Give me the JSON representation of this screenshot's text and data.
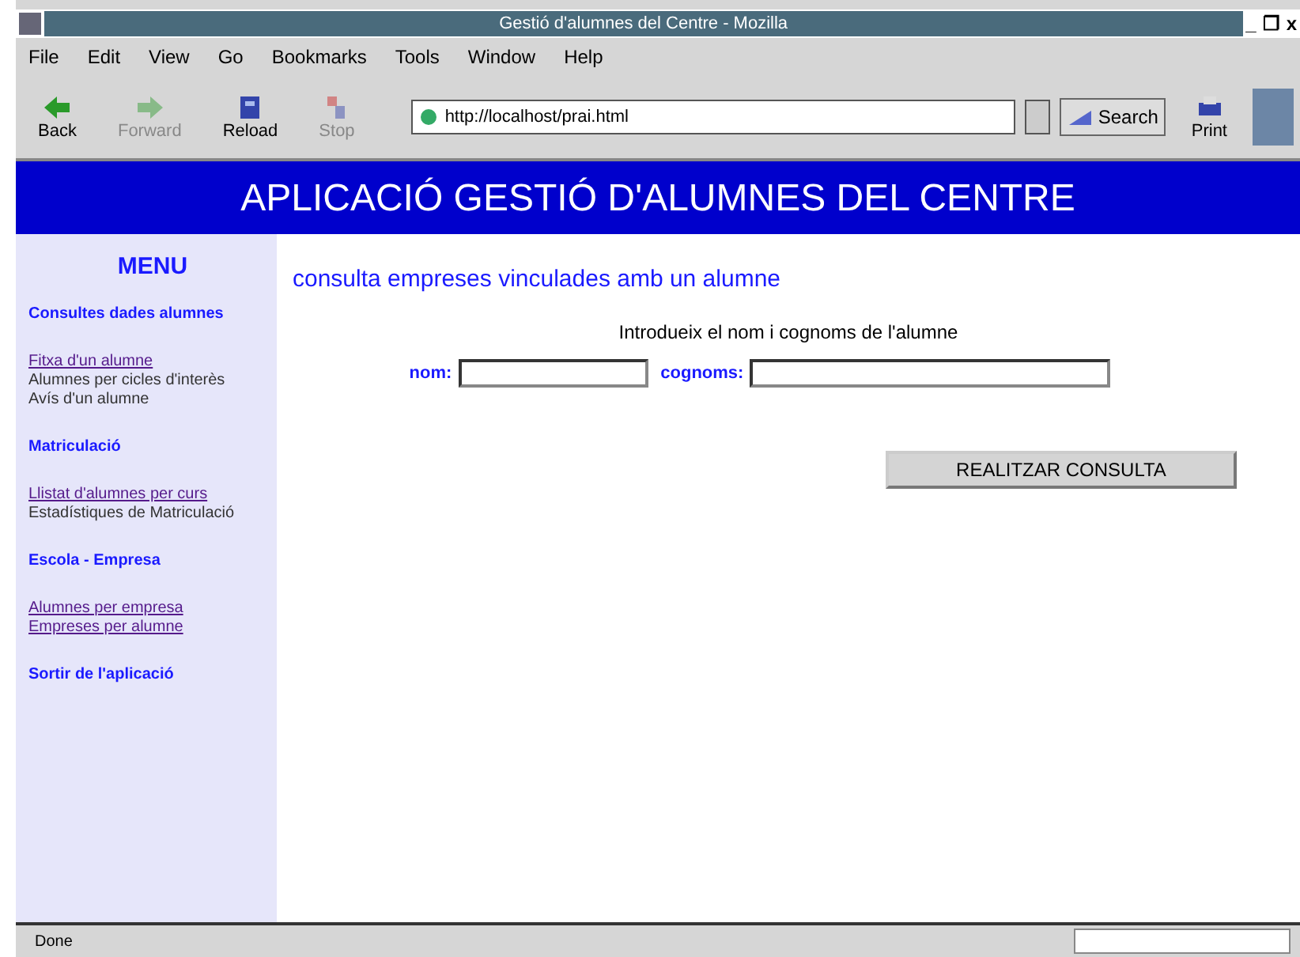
{
  "window": {
    "title": "Gestió d'alumnes del Centre - Mozilla",
    "controls": [
      "_",
      "❐",
      "x"
    ]
  },
  "menu_bar": [
    "File",
    "Edit",
    "View",
    "Go",
    "Bookmarks",
    "Tools",
    "Window",
    "Help"
  ],
  "toolbar": {
    "buttons": [
      {
        "label": "Back",
        "disabled": false
      },
      {
        "label": "Forward",
        "disabled": true
      },
      {
        "label": "Reload",
        "disabled": false
      },
      {
        "label": "Stop",
        "disabled": true
      }
    ],
    "address": "http://localhost/prai.html",
    "search": "Search",
    "print": "Print"
  },
  "banner": "APLICACIÓ GESTIÓ D'ALUMNES DEL CENTRE",
  "sidebar": {
    "title": "MENU",
    "items": [
      {
        "kind": "heading",
        "label": "Consultes dades alumnes"
      },
      {
        "kind": "link",
        "label": "Fitxa d'un alumne"
      },
      {
        "kind": "text",
        "label": "Alumnes per cicles d'interès"
      },
      {
        "kind": "text",
        "label": "Avís d'un alumne"
      },
      {
        "kind": "heading",
        "label": "Matriculació"
      },
      {
        "kind": "link",
        "label": "Llistat d'alumnes per curs"
      },
      {
        "kind": "text",
        "label": "Estadístiques de Matriculació"
      },
      {
        "kind": "heading",
        "label": "Escola - Empresa"
      },
      {
        "kind": "link",
        "label": "Alumnes per empresa"
      },
      {
        "kind": "link",
        "label": "Empreses per alumne"
      },
      {
        "kind": "heading",
        "label": "Sortir de l'aplicació"
      }
    ]
  },
  "content": {
    "heading": "consulta empreses vinculades amb un alumne",
    "instruction": "Introdueix el nom i cognoms de l'alumne",
    "fields": [
      {
        "label": "nom:"
      },
      {
        "label": "cognoms:"
      }
    ],
    "submit": "REALITZAR CONSULTA"
  },
  "status_bar": {
    "text": "Done"
  }
}
